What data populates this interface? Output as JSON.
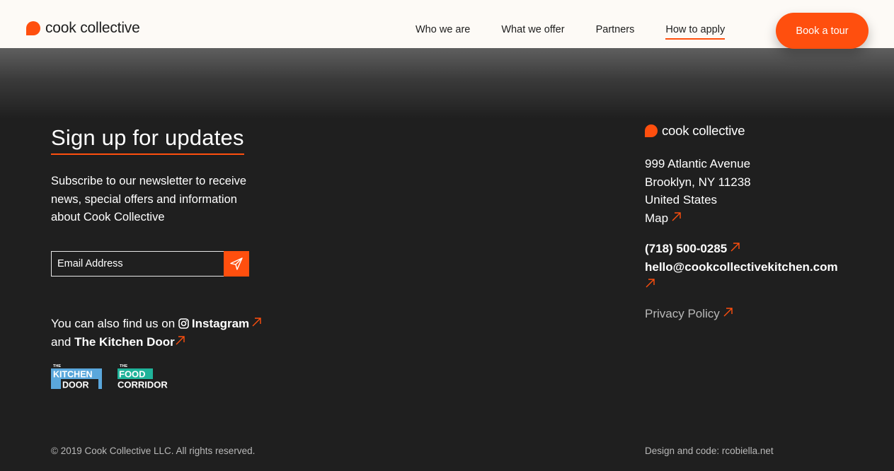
{
  "header": {
    "logo_text": "cook collective",
    "nav": [
      {
        "label": "Who we are"
      },
      {
        "label": "What we offer"
      },
      {
        "label": "Partners"
      },
      {
        "label": "How to apply"
      }
    ],
    "cta_label": "Book a tour"
  },
  "signup": {
    "title": "Sign up for updates",
    "description": "Subscribe to our newsletter to receive news, special offers and information about Cook Collective",
    "email_placeholder": "Email Address"
  },
  "social": {
    "prefix": "You can also find us on",
    "instagram": "Instagram",
    "and": "and",
    "kitchen_door": "The Kitchen Door"
  },
  "partner_logos": {
    "kitchen_door": {
      "the": "THE",
      "line1": "KITCHEN",
      "line2": "DOOR"
    },
    "food_corridor": {
      "the": "THE",
      "line1": "FOOD",
      "line2": "CORRIDOR"
    }
  },
  "footer": {
    "logo_text": "cook collective",
    "address": [
      "999 Atlantic Avenue",
      "Brooklyn, NY 11238",
      "United States"
    ],
    "map_label": "Map",
    "phone": "(718) 500-0285",
    "email": "hello@cookcollectivekitchen.com",
    "privacy": "Privacy Policy",
    "copyright": "© 2019 Cook Collective LLC. All rights reserved.",
    "credit": "Design and code: rcobiella.net"
  },
  "colors": {
    "accent": "#ff4f0e",
    "background": "#1f1f1f",
    "header_bg": "#fdfaf6"
  }
}
